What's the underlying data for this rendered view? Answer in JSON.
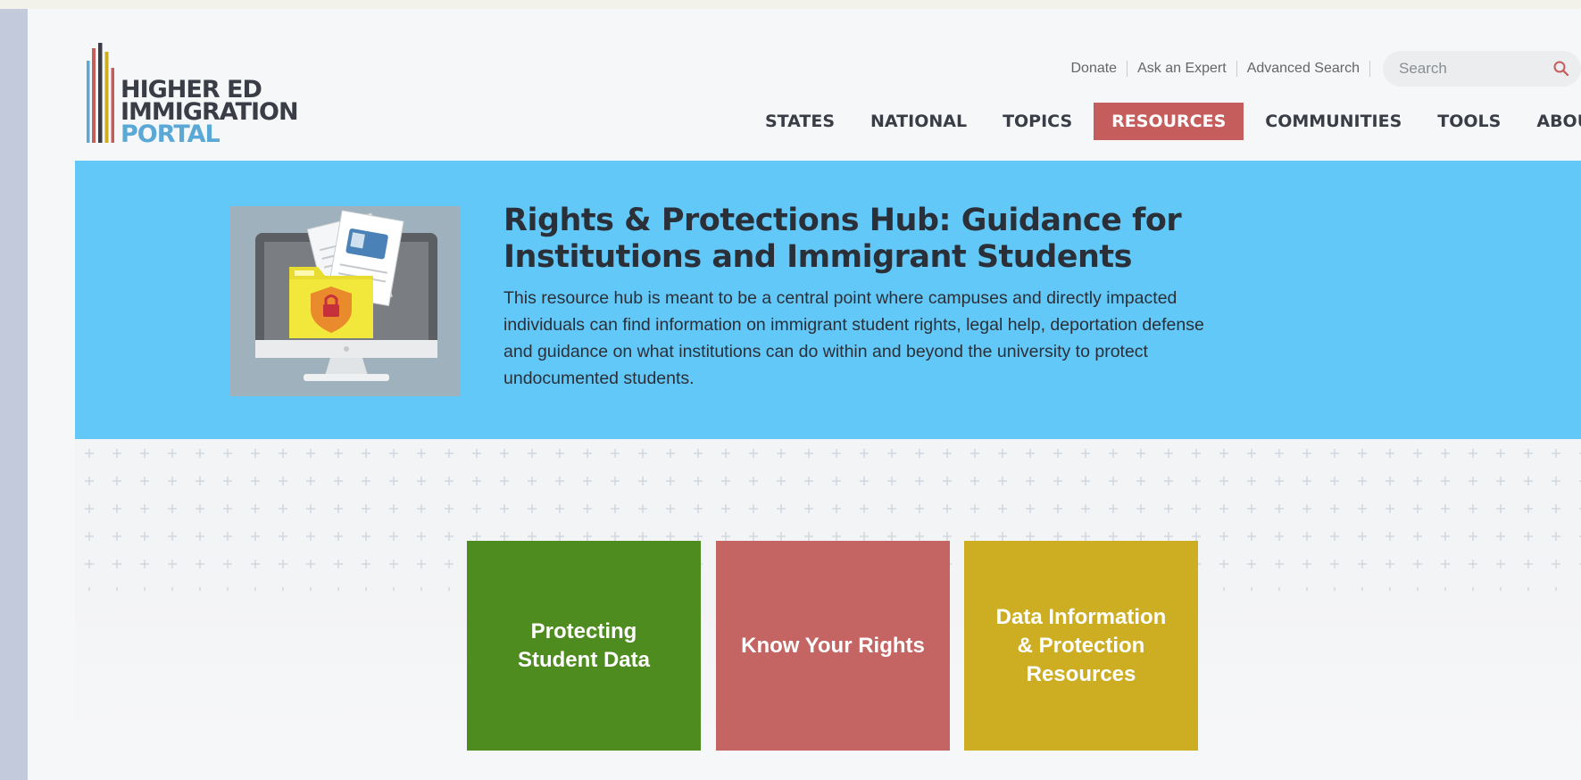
{
  "logo": {
    "line1": "HIGHER ED",
    "line2": "IMMIGRATION",
    "line3": "PORTAL"
  },
  "utility": {
    "donate": "Donate",
    "ask_expert": "Ask an Expert",
    "advanced_search": "Advanced Search",
    "search_placeholder": "Search"
  },
  "nav": {
    "items": [
      "STATES",
      "NATIONAL",
      "TOPICS",
      "RESOURCES",
      "COMMUNITIES",
      "TOOLS",
      "ABOUT"
    ],
    "active": "RESOURCES"
  },
  "hero": {
    "title": "Rights & Protections Hub: Guidance for Institutions and Immigrant Students",
    "description": "This resource hub is meant to be a central point where campuses and directly impacted individuals can find information on immigrant student rights, legal help, deportation defense and guidance on what institutions can do within and beyond the university to protect undocumented students.",
    "image_icon": "computer-folder-lock-icon"
  },
  "tiles": [
    {
      "label": "Protecting Student Data",
      "color": "#4f8c20"
    },
    {
      "label": "Know Your Rights",
      "color": "#c46564"
    },
    {
      "label": "Data Information & Protection Resources",
      "color": "#cdad22"
    }
  ],
  "colors": {
    "hero_bg": "#62c8f8",
    "nav_active_bg": "#c65d5d",
    "logo_blue": "#5aa8d6"
  }
}
